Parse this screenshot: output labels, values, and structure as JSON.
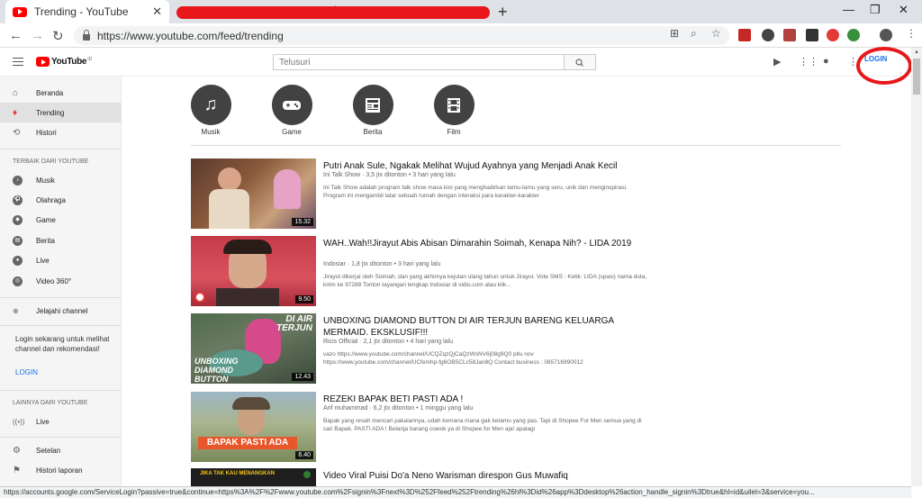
{
  "browser": {
    "tab_title": "Trending - YouTube",
    "url": "https://www.youtube.com/feed/trending",
    "status_url": "https://accounts.google.com/ServiceLogin?passive=true&continue=https%3A%2F%2Fwww.youtube.com%2Fsignin%3Fnext%3D%252Ffeed%252Ftrending%26hl%3Did%26app%3Ddesktop%26action_handle_signin%3Dtrue&hl=id&uilel=3&service=you..."
  },
  "youtube": {
    "logo_text": "YouTube",
    "logo_region": "ID",
    "search_placeholder": "Telusuri",
    "login_label": "LOGIN"
  },
  "sidebar": {
    "main": [
      {
        "label": "Beranda",
        "icon": "home-icon"
      },
      {
        "label": "Trending",
        "icon": "fire-icon"
      },
      {
        "label": "Histori",
        "icon": "history-icon"
      }
    ],
    "best_heading": "TERBAIK DARI YOUTUBE",
    "best": [
      {
        "label": "Musik",
        "icon": "music-icon"
      },
      {
        "label": "Olahraga",
        "icon": "sports-icon"
      },
      {
        "label": "Game",
        "icon": "game-icon"
      },
      {
        "label": "Berita",
        "icon": "news-icon"
      },
      {
        "label": "Live",
        "icon": "live-icon"
      },
      {
        "label": "Video 360°",
        "icon": "video360-icon"
      }
    ],
    "browse_channels": "Jelajahi channel",
    "login_note": "Login sekarang untuk melihat channel dan rekomendasi!",
    "login_link": "LOGIN",
    "more_heading": "LAINNYA DARI YOUTUBE",
    "more": [
      {
        "label": "Live",
        "icon": "broadcast-icon"
      }
    ],
    "settings": "Setelan",
    "report_history": "Histori laporan"
  },
  "categories": [
    {
      "label": "Musik",
      "icon": "music-note-icon"
    },
    {
      "label": "Game",
      "icon": "gamepad-icon"
    },
    {
      "label": "Berita",
      "icon": "newspaper-icon"
    },
    {
      "label": "Film",
      "icon": "film-icon"
    }
  ],
  "videos": [
    {
      "title": "Putri Anak Sule, Ngakak Melihat Wujud Ayahnya yang Menjadi Anak Kecil",
      "channel": "Ini Talk Show",
      "views": "3,5 jtx ditonton",
      "age": "3 hari yang lalu",
      "desc": "Ini Talk Show adalah program talk show masa kini yang menghadirkan tamu-tamu yang seru, unik dan menginspirasi. Program ini mengambil latar sebuah rumah dengan interaksi para karakter-karakter",
      "duration": "15.32"
    },
    {
      "title": "WAH..Wah!!Jirayut Abis Abisan Dimarahin Soimah, Kenapa Nih? - LIDA 2019",
      "channel": "Indosiar",
      "views": "1,8 jtx ditonton",
      "age": "3 hari yang lalu",
      "desc": "Jirayut dikerjai oleh Soimah, dan yang akhirnya kejutan ulang tahun untuk Jirayut. Vote SMS : Ketik: LIDA (spasi) nama duta, kirim ke 97288 Tonton tayangan lengkap Indosiar di vidio.com atau klik...",
      "duration": "9.50"
    },
    {
      "title": "UNBOXING DIAMOND BUTTON DI AIR TERJUN BARENG KELUARGA MERMAID. EKSKLUSIF!!!",
      "channel": "Ricis Official",
      "views": "2,1 jtx ditonton",
      "age": "4 hari yang lalu",
      "desc": "vazo https://www.youtube.com/channel/UCQZqzQjCaQzWsNV6j08g9Q0 pitu nov https://www.youtube.com/channel/UCfemhp-fg6OB5CLc58Jan8Q Contact business : 085716990012",
      "duration": "12.43"
    },
    {
      "title": "REZEKI BAPAK BETI PASTI ADA !",
      "channel": "Arif muhammad",
      "views": "6,2 jtx ditonton",
      "age": "1 minggu yang lalu",
      "desc": "Bapak yang resah mencari pakaiannya, udah kemana mana gak ketamu yang pas. Tapi di Shopee For Men semua yang di cari Bapak. PASTI ADA ! Belanja barang cowok ya di Shopee for Men aja! apalagi",
      "duration": "6.40"
    },
    {
      "title": "Video Viral Puisi Do'a Neno Warisman direspon Gus Muwafiq"
    }
  ],
  "thumb_texts": {
    "v3_top": "DI AIR TERJUN",
    "v3_bottom": "UNBOXING DIAMOND BUTTON",
    "v4_banner": "BAPAK PASTI ADA",
    "v5_banner": "JIKA TAK KAU MENANGKAN"
  }
}
